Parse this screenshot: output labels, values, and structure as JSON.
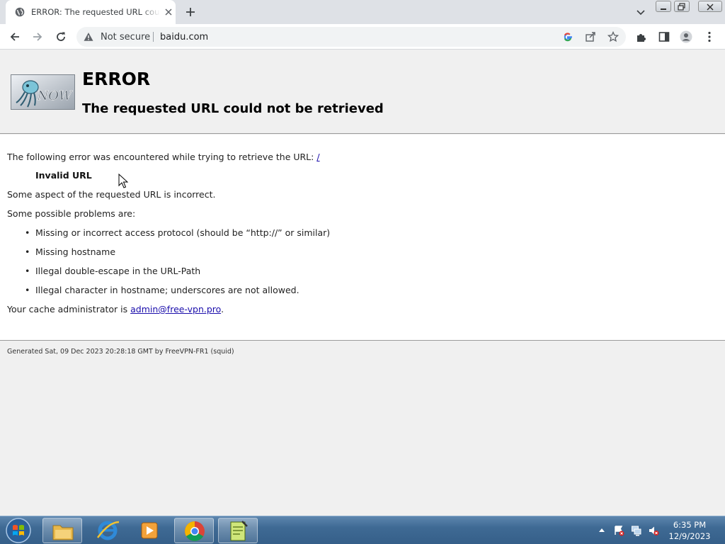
{
  "browser": {
    "tab_title": "ERROR: The requested URL could not be retrieved",
    "security_label": "Not secure",
    "url": "baidu.com"
  },
  "error_page": {
    "title": "ERROR",
    "subtitle": "The requested URL could not be retrieved",
    "intro": "The following error was encountered while trying to retrieve the URL:",
    "intro_link": "/",
    "error_type": "Invalid URL",
    "aspect": "Some aspect of the requested URL is incorrect.",
    "problems_heading": "Some possible problems are:",
    "problems": [
      "Missing or incorrect access protocol (should be “http://” or similar)",
      "Missing hostname",
      "Illegal double-escape in the URL-Path",
      "Illegal character in hostname; underscores are not allowed."
    ],
    "admin_prefix": "Your cache administrator is",
    "admin_email": "admin@free-vpn.pro",
    "admin_suffix": ".",
    "generated": "Generated Sat, 09 Dec 2023 20:28:18 GMT by FreeVPN-FR1 (squid)",
    "logo_text": "NOW"
  },
  "taskbar": {
    "time": "6:35 PM",
    "date": "12/9/2023"
  },
  "colors": {
    "link": "#1a0dab",
    "taskbar": "#3f6a94",
    "page_bg": "#f0f0f0"
  }
}
